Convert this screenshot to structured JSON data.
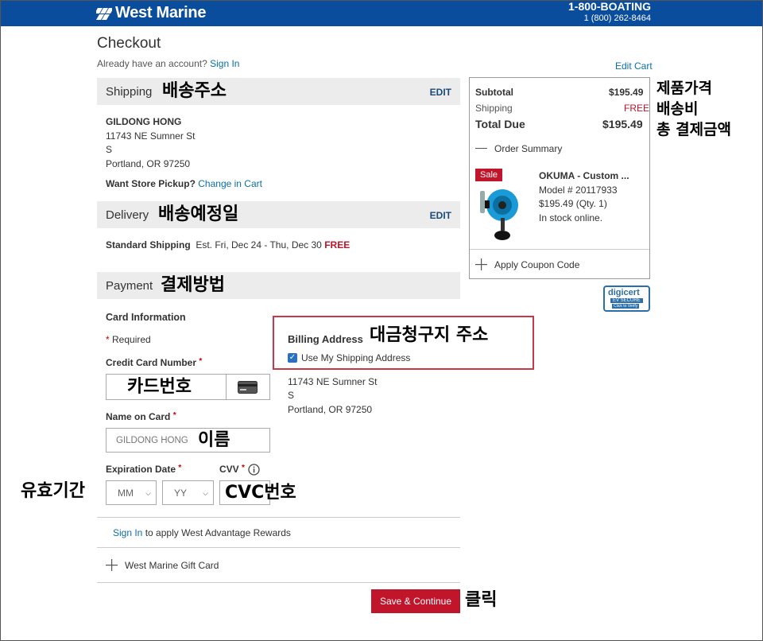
{
  "header": {
    "logo_text": "West Marine",
    "phone_label": "1-800-BOATING",
    "phone_number": "1 (800) 262-8464",
    "bg_color": "#0a4d9c"
  },
  "page_title": "Checkout",
  "account": {
    "prefix": "Already have an account?",
    "sign_in": "Sign In"
  },
  "edit_cart": "Edit Cart",
  "shipping": {
    "title": "Shipping",
    "annotation": "배송주소",
    "edit": "EDIT",
    "name": "GILDONG HONG",
    "street": "11743 NE Sumner St",
    "line2": "S",
    "city": "Portland, OR 97250",
    "pickup_label": "Want Store Pickup?",
    "pickup_link": "Change in Cart"
  },
  "delivery": {
    "title": "Delivery",
    "annotation": "배송예정일",
    "edit": "EDIT",
    "method": "Standard Shipping",
    "estimate": "Est. Fri, Dec 24 - Thu, Dec 30",
    "cost": "FREE"
  },
  "payment": {
    "title": "Payment",
    "annotation": "결제방법",
    "card_info": "Card Information",
    "required": "Required",
    "card_number_label": "Credit Card Number",
    "card_number_annotation": "카드번호",
    "name_label": "Name on Card",
    "name_value": "GILDONG HONG",
    "name_annotation": "이름",
    "expiration_label": "Expiration Date",
    "expiration_annotation": "유효기간",
    "month_value": "MM",
    "year_value": "YY",
    "cvv_label": "CVV",
    "cvv_annotation": "CVC번호",
    "rewards_link": "Sign In",
    "rewards_text": "to apply West Advantage Rewards",
    "gift_card": "West Marine Gift Card"
  },
  "billing": {
    "title": "Billing Address",
    "annotation": "대금청구지 주소",
    "checkbox_label": "Use My Shipping Address",
    "checked": true,
    "street": "11743 NE Sumner St",
    "line2": "S",
    "city": "Portland, OR 97250"
  },
  "summary": {
    "subtotal_label": "Subtotal",
    "subtotal_value": "$195.49",
    "shipping_label": "Shipping",
    "shipping_value": "FREE",
    "total_label": "Total Due",
    "total_value": "$195.49",
    "order_summary": "Order Summary",
    "sale_badge": "Sale",
    "product_name": "OKUMA - Custom ...",
    "model": "Model # 20117933",
    "price_qty": "$195.49 (Qty. 1)",
    "stock": "In stock online.",
    "coupon": "Apply Coupon Code",
    "annotations": [
      "제품가격",
      "배송비",
      "총 결제금액"
    ]
  },
  "digicert": {
    "brand": "digicert",
    "line1": "EV SECURE",
    "line2": "Click to Verify"
  },
  "save_button": "Save & Continue",
  "save_annotation": "클릭"
}
